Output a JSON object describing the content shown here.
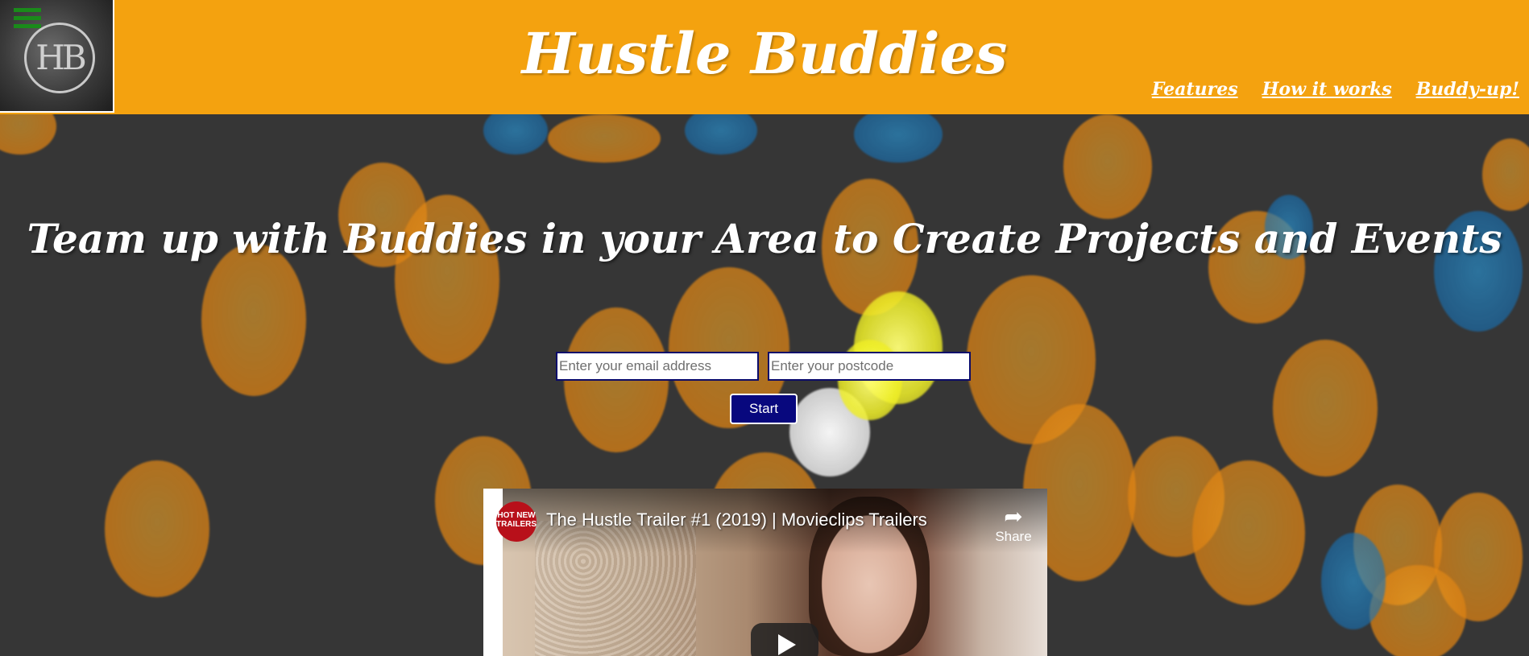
{
  "header": {
    "site_title": "Hustle Buddies",
    "logo_text": "HB",
    "menu_icon": "hamburger-menu-icon",
    "bg_color": "#f4a20f",
    "nav": [
      {
        "label": "Features"
      },
      {
        "label": "How it works"
      },
      {
        "label": "Buddy-up!"
      }
    ]
  },
  "hero": {
    "heading": "Team up with Buddies in your Area to Create Projects and Events",
    "email_placeholder": "Enter your email address",
    "postcode_placeholder": "Enter your postcode",
    "start_label": "Start",
    "start_color": "#08087e"
  },
  "video": {
    "channel_badge": "HOT NEW TRAILERS",
    "title": "The Hustle Trailer #1 (2019) | Movieclips Trailers",
    "share_label": "Share",
    "share_icon": "share-arrow-icon",
    "play_icon": "play-icon"
  }
}
